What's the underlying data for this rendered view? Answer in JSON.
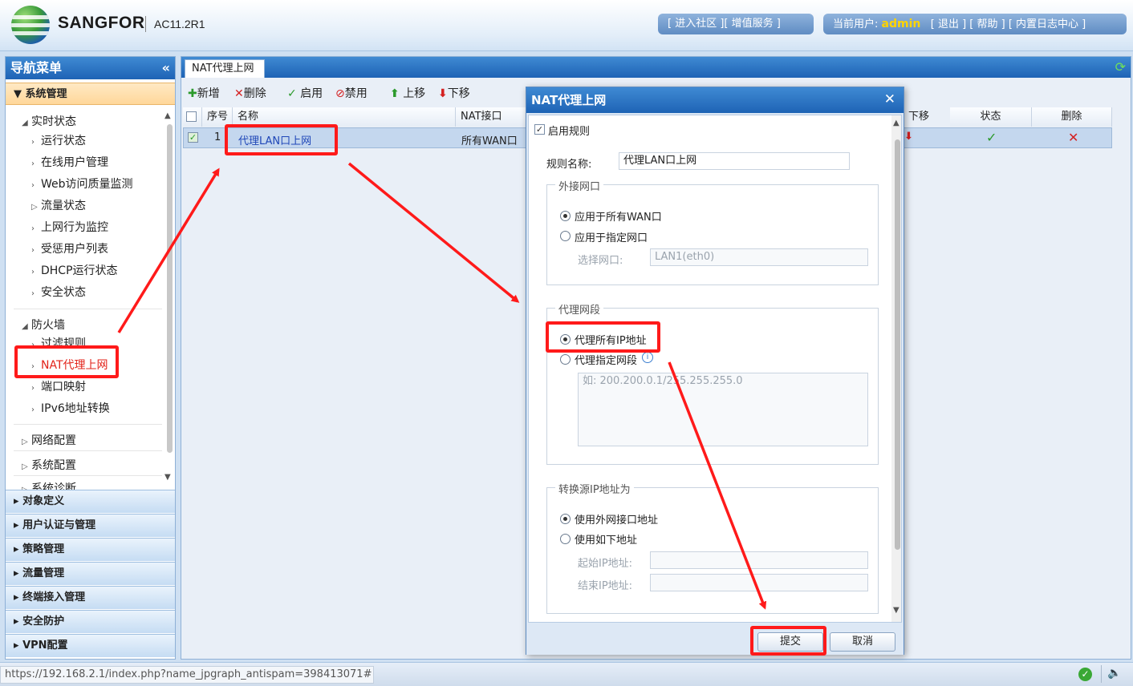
{
  "header": {
    "brand": "SANGFOR",
    "version": "AC11.2R1",
    "links_left": "[ 进入社区 ][ 增值服务 ]",
    "user_label": "当前用户:",
    "username": "admin",
    "links_right": "[ 退出 ] [ 帮助 ] [ 内置日志中心 ]"
  },
  "nav": {
    "title": "导航菜单",
    "collapse_icon": "«",
    "system_mgmt": "系统管理",
    "realtime": "实时状态",
    "realtime_items": [
      "运行状态",
      "在线用户管理",
      "Web访问质量监测",
      "流量状态",
      "上网行为监控",
      "受惩用户列表",
      "DHCP运行状态",
      "安全状态"
    ],
    "firewall": "防火墙",
    "firewall_items": [
      "过滤规则",
      "NAT代理上网",
      "端口映射",
      "IPv6地址转换"
    ],
    "network_config": "网络配置",
    "system_config": "系统配置",
    "system_diag": "系统诊断",
    "sections": [
      "对象定义",
      "用户认证与管理",
      "策略管理",
      "流量管理",
      "终端接入管理",
      "安全防护",
      "VPN配置"
    ]
  },
  "main": {
    "tab": "NAT代理上网",
    "toolbar": {
      "add": "新增",
      "delete": "删除",
      "enable": "启用",
      "disable": "禁用",
      "up": "上移",
      "down": "下移"
    },
    "columns": {
      "seq": "序号",
      "name": "名称",
      "nat_if": "NAT接口",
      "move_down": "下移",
      "state": "状态",
      "delete": "删除"
    },
    "row": {
      "seq": "1",
      "name": "代理LAN口上网",
      "nat_if": "所有WAN口"
    }
  },
  "dialog": {
    "title": "NAT代理上网",
    "enable_rule": "启用规则",
    "rule_name_label": "规则名称:",
    "rule_name_value": "代理LAN口上网",
    "outbound": {
      "legend": "外接网口",
      "opt_all": "应用于所有WAN口",
      "opt_specific": "应用于指定网口",
      "select_label": "选择网口:",
      "select_value": "LAN1(eth0)"
    },
    "proxy": {
      "legend": "代理网段",
      "opt_all": "代理所有IP地址",
      "opt_specific": "代理指定网段",
      "placeholder": "如: 200.200.0.1/255.255.255.0"
    },
    "translate": {
      "legend": "转换源IP地址为",
      "opt_if": "使用外网接口地址",
      "opt_custom": "使用如下地址",
      "start_label": "起始IP地址:",
      "end_label": "结束IP地址:"
    },
    "submit": "提交",
    "cancel": "取消"
  },
  "status_url": "https://192.168.2.1/index.php?name_jpgraph_antispam=398413071#",
  "colors": {
    "accent": "#1e63b5",
    "annotation": "#ff1a1a",
    "brand_user": "#ffd400"
  }
}
